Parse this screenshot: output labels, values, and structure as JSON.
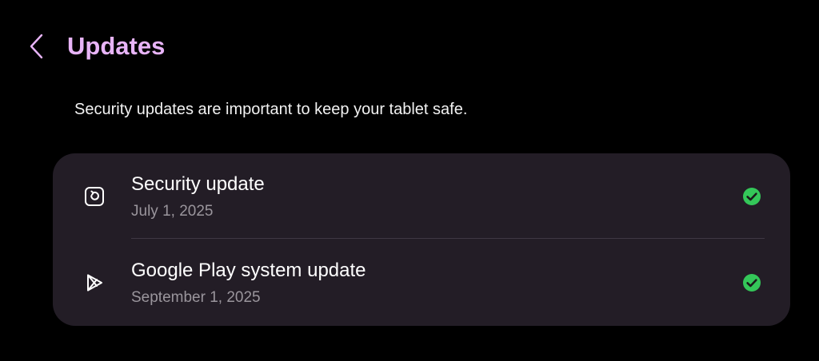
{
  "header": {
    "title": "Updates",
    "back_icon": "chevron-left-icon"
  },
  "description": "Security updates are important to keep your tablet safe.",
  "updates": [
    {
      "title": "Security update",
      "date": "July 1, 2025",
      "icon": "security-update-icon",
      "status_icon": "check-circle-icon"
    },
    {
      "title": "Google Play system update",
      "date": "September 1, 2025",
      "icon": "google-play-icon",
      "status_icon": "check-circle-icon"
    }
  ],
  "colors": {
    "background": "#000000",
    "title_accent": "#e8b4f8",
    "card_background": "#231d26",
    "subtext": "#9a959c",
    "status_ok": "#34c759"
  }
}
